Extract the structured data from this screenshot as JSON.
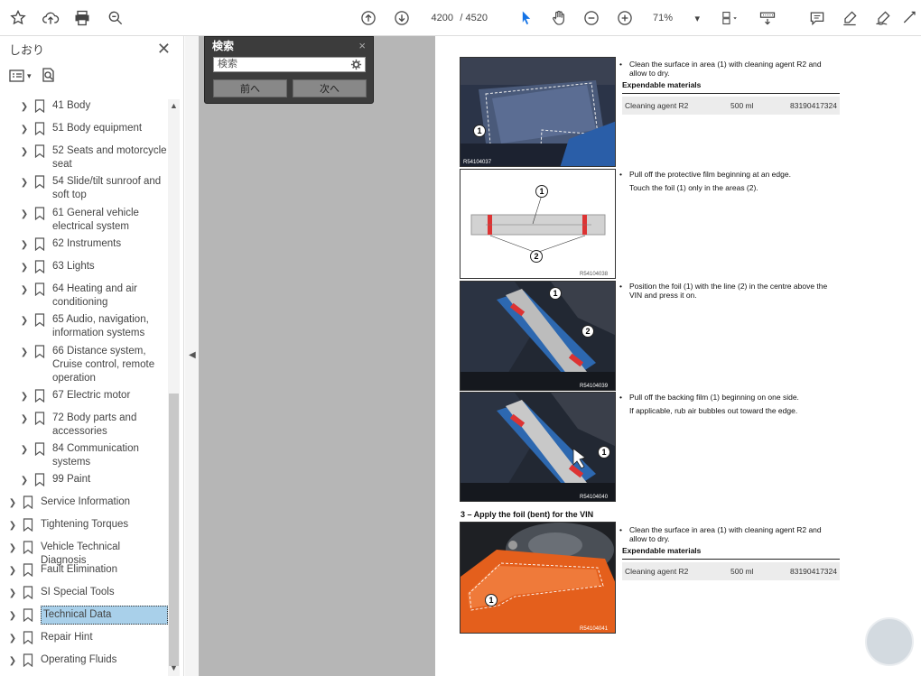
{
  "toolbar": {
    "page_current": "4200",
    "page_total": "/ 4520",
    "zoom": "71%"
  },
  "sidebar": {
    "title": "しおり",
    "bookmarks": [
      {
        "label": "41 Body",
        "level": 1
      },
      {
        "label": "51 Body equipment",
        "level": 1
      },
      {
        "label": "52 Seats and motorcycle seat",
        "level": 1
      },
      {
        "label": "54 Slide/tilt sunroof and soft top",
        "level": 1
      },
      {
        "label": "61 General vehicle electrical system",
        "level": 1
      },
      {
        "label": "62 Instruments",
        "level": 1
      },
      {
        "label": "63 Lights",
        "level": 1
      },
      {
        "label": "64 Heating and air conditioning",
        "level": 1
      },
      {
        "label": "65 Audio, navigation, information systems",
        "level": 1
      },
      {
        "label": "66 Distance system, Cruise control, remote operation",
        "level": 1
      },
      {
        "label": "67 Electric motor",
        "level": 1
      },
      {
        "label": "72 Body parts and accessories",
        "level": 1
      },
      {
        "label": "84 Communication systems",
        "level": 1
      },
      {
        "label": "99 Paint",
        "level": 1
      },
      {
        "label": "Service Information",
        "level": 0
      },
      {
        "label": "Tightening Torques",
        "level": 0
      },
      {
        "label": "Vehicle Technical Diagnosis",
        "level": 0
      },
      {
        "label": "Fault Elimination",
        "level": 0
      },
      {
        "label": "SI Special Tools",
        "level": 0
      },
      {
        "label": "Technical Data",
        "level": 0,
        "selected": true
      },
      {
        "label": "Repair Hint",
        "level": 0
      },
      {
        "label": "Operating Fluids",
        "level": 0
      }
    ]
  },
  "search": {
    "title": "検索",
    "close": "×",
    "value": "検索",
    "prev_label": "前へ",
    "next_label": "次へ"
  },
  "page": {
    "step1_text": "Clean the surface in area (1) with cleaning agent R2 and allow to dry.",
    "expendable_heading": "Expendable materials",
    "material_name": "Cleaning agent R2",
    "material_qty": "500 ml",
    "material_number": "83190417324",
    "step2_text": "Pull off the protective film beginning at an edge.",
    "step2_sub": "Touch the foil (1) only in the areas (2).",
    "step3_text": "Position the foil (1) with the line (2) in the centre above the VIN and press it on.",
    "step4_text": "Pull off the backing film (1) beginning on one side.",
    "step4_sub": "If applicable, rub air bubbles out toward the edge.",
    "section_title": "3 – Apply the foil (bent) for the VIN",
    "step5_text": "Clean the surface in area (1) with cleaning agent R2 and allow to dry.",
    "expendable_heading_2": "Expendable materials",
    "material_name_2": "Cleaning agent R2",
    "material_qty_2": "500 ml",
    "material_number_2": "83190417324",
    "img1_id": "R54104037",
    "img2_id": "R54104038",
    "img3_id": "R54104039",
    "img4_id": "R54104040",
    "img5_id": "R54104041",
    "c1": "1",
    "c2": "2"
  }
}
